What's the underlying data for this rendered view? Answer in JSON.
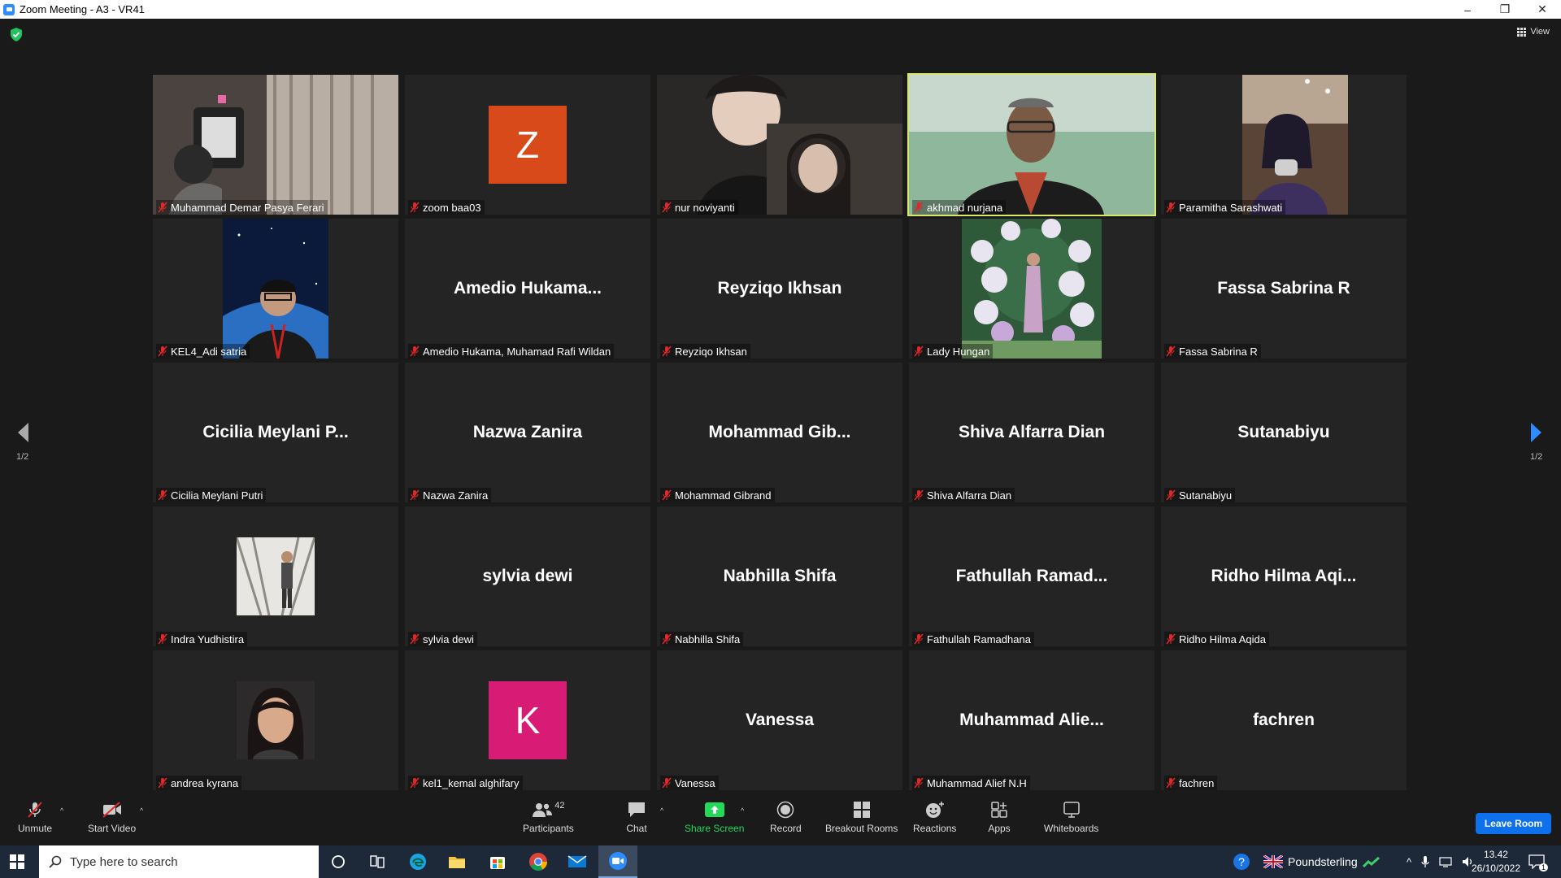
{
  "window": {
    "title": "Zoom Meeting - A3 - VR41",
    "view_label": "View"
  },
  "pager": {
    "left_label": "1/2",
    "right_label": "1/2"
  },
  "participants": [
    {
      "big_name": "",
      "label": "Muhammad Demar Pasya Ferari",
      "type": "video",
      "scene": "room"
    },
    {
      "big_name": "",
      "label": "zoom baa03",
      "type": "avatar",
      "initial": "Z",
      "color": "#d94a1a"
    },
    {
      "big_name": "",
      "label": "nur noviyanti",
      "type": "video",
      "scene": "portrait-dark"
    },
    {
      "big_name": "",
      "label": "akhmad nurjana",
      "type": "video",
      "scene": "man-green",
      "active": true
    },
    {
      "big_name": "",
      "label": "Paramitha Sarashwati",
      "type": "video",
      "scene": "mirror"
    },
    {
      "big_name": "",
      "label": "KEL4_Adi satria",
      "type": "video",
      "scene": "space"
    },
    {
      "big_name": "Amedio  Hukama...",
      "label": "Amedio Hukama, Muhamad Rafi Wildan",
      "type": "name"
    },
    {
      "big_name": "Reyziqo Ikhsan",
      "label": "Reyziqo Ikhsan",
      "type": "name"
    },
    {
      "big_name": "",
      "label": "Lady Hungan",
      "type": "video",
      "scene": "flowers"
    },
    {
      "big_name": "Fassa Sabrina R",
      "label": "Fassa Sabrina R",
      "type": "name"
    },
    {
      "big_name": "Cicilia  Meylani  P...",
      "label": "Cicilia Meylani Putri",
      "type": "name"
    },
    {
      "big_name": "Nazwa Zanira",
      "label": "Nazwa Zanira",
      "type": "name"
    },
    {
      "big_name": "Mohammad  Gib...",
      "label": "Mohammad Gibrand",
      "type": "name"
    },
    {
      "big_name": "Shiva Alfarra Dian",
      "label": "Shiva Alfarra Dian",
      "type": "name"
    },
    {
      "big_name": "Sutanabiyu",
      "label": "Sutanabiyu",
      "type": "name"
    },
    {
      "big_name": "",
      "label": "Indra Yudhistira",
      "type": "photo",
      "scene": "building"
    },
    {
      "big_name": "sylvia dewi",
      "label": "sylvia dewi",
      "type": "name"
    },
    {
      "big_name": "Nabhilla Shifa",
      "label": "Nabhilla Shifa",
      "type": "name"
    },
    {
      "big_name": "Fathullah  Ramad...",
      "label": "Fathullah Ramadhana",
      "type": "name"
    },
    {
      "big_name": "Ridho  Hilma  Aqi...",
      "label": "Ridho Hilma Aqida",
      "type": "name"
    },
    {
      "big_name": "",
      "label": "andrea kyrana",
      "type": "photo",
      "scene": "girl"
    },
    {
      "big_name": "",
      "label": "kel1_kemal alghifary",
      "type": "avatar",
      "initial": "K",
      "color": "#d81b74"
    },
    {
      "big_name": "Vanessa",
      "label": "Vanessa",
      "type": "name"
    },
    {
      "big_name": "Muhammad  Alie...",
      "label": "Muhammad Alief N.H",
      "type": "name"
    },
    {
      "big_name": "fachren",
      "label": "fachren",
      "type": "name"
    }
  ],
  "toolbar": {
    "unmute": "Unmute",
    "start_video": "Start Video",
    "participants": "Participants",
    "participants_count": "42",
    "chat": "Chat",
    "share_screen": "Share Screen",
    "record": "Record",
    "breakout_rooms": "Breakout Rooms",
    "reactions": "Reactions",
    "apps": "Apps",
    "whiteboards": "Whiteboards",
    "leave": "Leave Room"
  },
  "taskbar": {
    "search_placeholder": "Type here to search",
    "language": "Poundsterling",
    "time": "13.42",
    "date": "26/10/2022",
    "notification_count": "1"
  },
  "colors": {
    "share_green": "#23d959",
    "leave_blue": "#0e71eb",
    "active_border": "#d9e86a",
    "muted_red": "#e02828"
  }
}
